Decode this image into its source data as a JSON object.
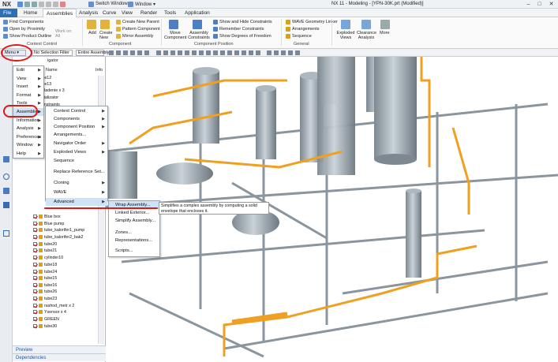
{
  "app": {
    "logo": "NX",
    "title": "NX 11 - Modeling - [YPN-30K.prt (Modified)]",
    "switch_window": "Switch Window",
    "window_menu": "Window ▾"
  },
  "tabs": [
    "File",
    "Home",
    "Assemblies",
    "Analysis",
    "Curve",
    "View",
    "Render",
    "Tools",
    "Application"
  ],
  "ribbon": {
    "find_components": "Find Components",
    "open_by_proximity": "Open by Proximity",
    "show_product_outline": "Show Product Outline",
    "work_on_all": "Work on All",
    "context_control_group": "Context Control",
    "add": "Add",
    "create_new": "Create New",
    "create_new_parent": "Create New Parent",
    "pattern_component": "Pattern Component",
    "mirror_assembly": "Mirror Assembly",
    "component_group": "Component",
    "move_component": "Move Component",
    "assembly_constraints": "Assembly Constraints",
    "show_hide_constraints": "Show and Hide Constraints",
    "remember_constraints": "Remember Constraints",
    "show_dof": "Show Degrees of Freedom",
    "component_position_group": "Component Position",
    "wave_geometry_linker": "WAVE Geometry Linker",
    "arrangements": "Arrangements",
    "sequence": "Sequence",
    "general_group": "General",
    "exploded_views": "Exploded Views",
    "clearance_analysis": "Clearance Analysis",
    "more": "More"
  },
  "selbar": {
    "menu": "Menu ▾",
    "filter": "No Selection Filter",
    "scope": "Entire Assembly"
  },
  "nav": {
    "header_label": "igator",
    "col_name": "Name",
    "col_info": "Info",
    "rows": [
      "tube12",
      "tube13",
      "Ohladenie x 3",
      "Katalizator",
      "Constraints",
      "Blue box",
      "Blue pump",
      "tube_kalorifer1_pump",
      "tube_kalorifer2_bak2",
      "tube20",
      "tube21",
      "cylinder10",
      "tube18",
      "tube24",
      "tube15",
      "tube16",
      "tube26",
      "tube23",
      "rashod_metr x 2",
      "Ysensor x 4",
      "GREEN",
      "tube30"
    ]
  },
  "main_menu": [
    "Edit",
    "View",
    "Insert",
    "Format",
    "Tools",
    "Assemblies",
    "Information",
    "Analysis",
    "Preferences",
    "Window",
    "Help"
  ],
  "assemblies_menu": [
    "Context Control",
    "Components",
    "Component Position",
    "Arrangements...",
    "Navigator Order",
    "Exploded Views",
    "Sequence",
    "Replace Reference Set...",
    "Cloning",
    "WAVE",
    "Advanced"
  ],
  "advanced_menu": [
    "Wrap Assembly...",
    "Linked Exterior...",
    "Simplify Assembly...",
    "Zones...",
    "Representations...",
    "Scripts..."
  ],
  "tooltip": "Simplifies a complex assembly by computing a solid envelope that encloses it.",
  "bottom_panels": [
    "Preview",
    "Dependencies"
  ],
  "colors": {
    "file_tab": "#2b6fb5",
    "highlight": "#cfe3f7",
    "annotation": "#e01818",
    "steel": "#aab4bc",
    "pipe": "#f0a020"
  }
}
